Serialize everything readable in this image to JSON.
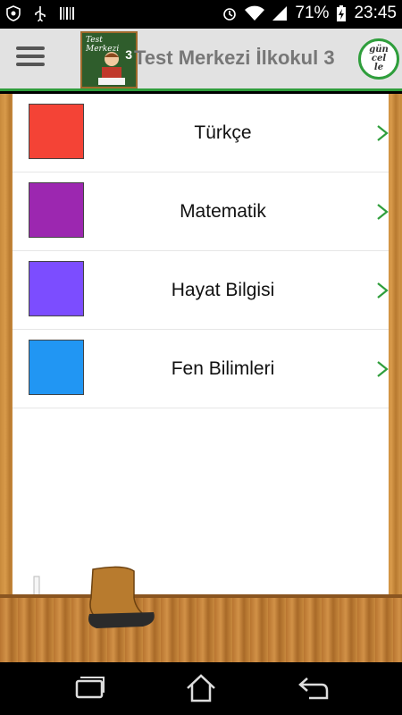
{
  "status_bar": {
    "battery_percent": "71%",
    "time": "23:45",
    "icons": [
      "shield-icon",
      "usb-icon",
      "barcode-icon",
      "alarm-icon",
      "wifi-icon",
      "signal-icon",
      "battery-charging-icon"
    ]
  },
  "header": {
    "title": "Test Merkezi İlkokul 3",
    "logo_text": "Test Merkezi",
    "logo_number": "3",
    "update_button_lines": [
      "gün",
      "cel",
      "le"
    ]
  },
  "subjects": [
    {
      "label": "Türkçe",
      "color": "#f44336"
    },
    {
      "label": "Matematik",
      "color": "#9c27b0"
    },
    {
      "label": "Hayat Bilgisi",
      "color": "#7c4dff"
    },
    {
      "label": "Fen Bilimleri",
      "color": "#2196f3"
    }
  ],
  "colors": {
    "accent": "#2f9e3c",
    "wood": "#c88a3c",
    "action_bar": "#e2e2e2"
  },
  "nav_bar": {
    "icons": [
      "recent-apps-icon",
      "home-icon",
      "back-icon"
    ]
  }
}
